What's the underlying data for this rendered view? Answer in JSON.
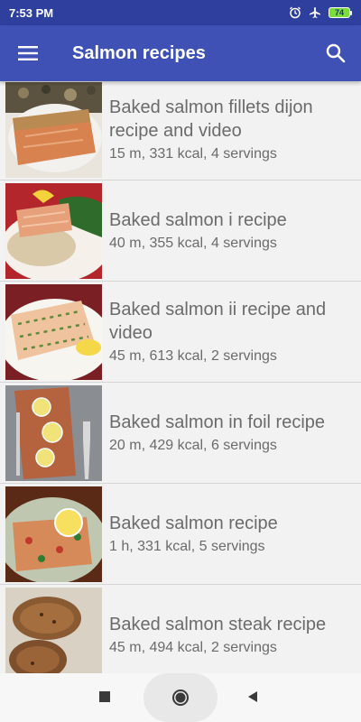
{
  "status_bar": {
    "time": "7:53 PM",
    "battery_level": "74"
  },
  "app_bar": {
    "title": "Salmon recipes",
    "menu_icon": "hamburger-menu-icon",
    "search_icon": "search-icon"
  },
  "recipes": [
    {
      "title": "Baked salmon fillets dijon recipe and video",
      "meta": "15 m, 331 kcal, 4 servings"
    },
    {
      "title": "Baked salmon i recipe",
      "meta": "40 m, 355 kcal, 4 servings"
    },
    {
      "title": "Baked salmon ii recipe and video",
      "meta": "45 m, 613 kcal, 2 servings"
    },
    {
      "title": "Baked salmon in foil  recipe",
      "meta": "20 m, 429 kcal, 6 servings"
    },
    {
      "title": "Baked salmon recipe",
      "meta": "1 h, 331 kcal, 5 servings"
    },
    {
      "title": "Baked salmon steak recipe",
      "meta": "45 m, 494 kcal, 2 servings"
    }
  ],
  "nav_bar": {
    "recent_icon": "square-icon",
    "home_icon": "circle-icon",
    "back_icon": "triangle-back-icon"
  }
}
